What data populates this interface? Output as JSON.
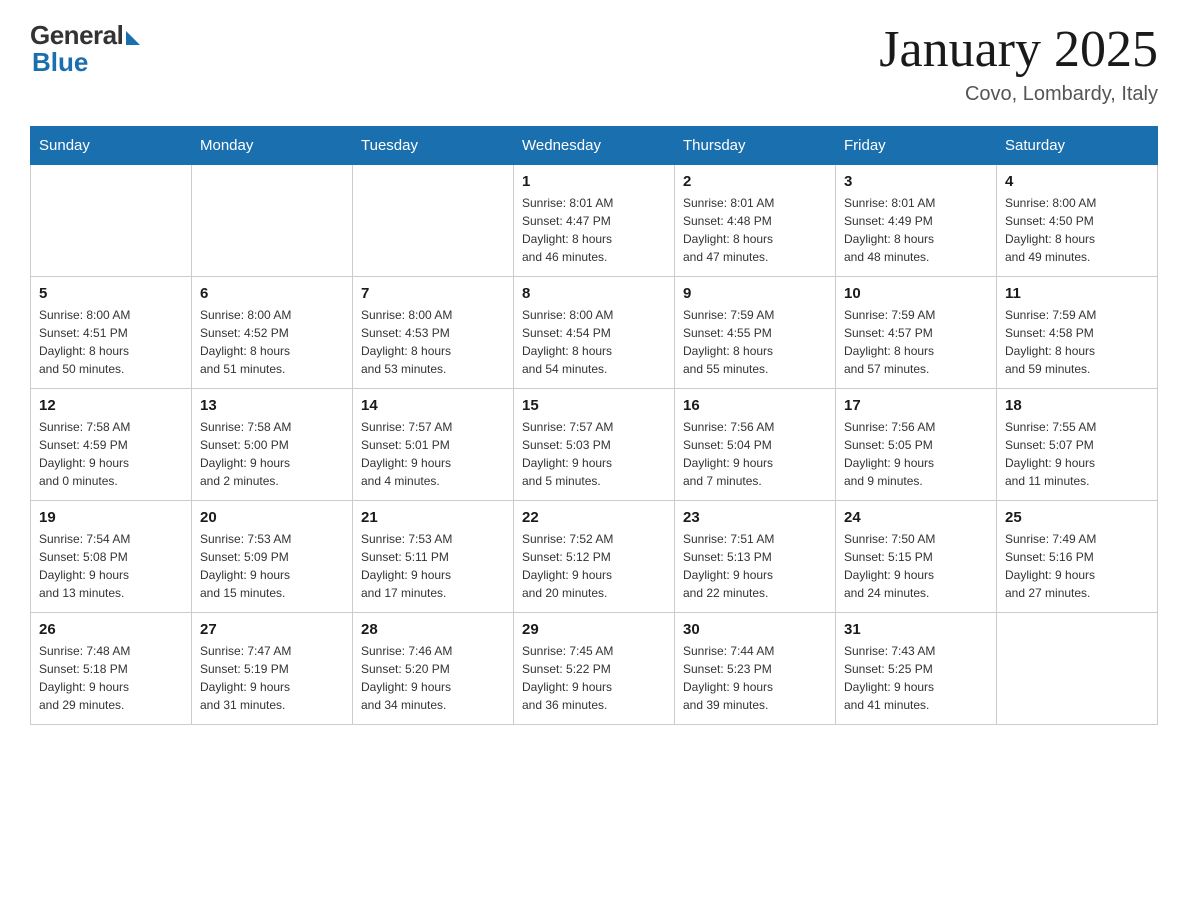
{
  "header": {
    "logo_general": "General",
    "logo_blue": "Blue",
    "month_year": "January 2025",
    "location": "Covo, Lombardy, Italy"
  },
  "days_of_week": [
    "Sunday",
    "Monday",
    "Tuesday",
    "Wednesday",
    "Thursday",
    "Friday",
    "Saturday"
  ],
  "weeks": [
    [
      {
        "num": "",
        "info": ""
      },
      {
        "num": "",
        "info": ""
      },
      {
        "num": "",
        "info": ""
      },
      {
        "num": "1",
        "info": "Sunrise: 8:01 AM\nSunset: 4:47 PM\nDaylight: 8 hours\nand 46 minutes."
      },
      {
        "num": "2",
        "info": "Sunrise: 8:01 AM\nSunset: 4:48 PM\nDaylight: 8 hours\nand 47 minutes."
      },
      {
        "num": "3",
        "info": "Sunrise: 8:01 AM\nSunset: 4:49 PM\nDaylight: 8 hours\nand 48 minutes."
      },
      {
        "num": "4",
        "info": "Sunrise: 8:00 AM\nSunset: 4:50 PM\nDaylight: 8 hours\nand 49 minutes."
      }
    ],
    [
      {
        "num": "5",
        "info": "Sunrise: 8:00 AM\nSunset: 4:51 PM\nDaylight: 8 hours\nand 50 minutes."
      },
      {
        "num": "6",
        "info": "Sunrise: 8:00 AM\nSunset: 4:52 PM\nDaylight: 8 hours\nand 51 minutes."
      },
      {
        "num": "7",
        "info": "Sunrise: 8:00 AM\nSunset: 4:53 PM\nDaylight: 8 hours\nand 53 minutes."
      },
      {
        "num": "8",
        "info": "Sunrise: 8:00 AM\nSunset: 4:54 PM\nDaylight: 8 hours\nand 54 minutes."
      },
      {
        "num": "9",
        "info": "Sunrise: 7:59 AM\nSunset: 4:55 PM\nDaylight: 8 hours\nand 55 minutes."
      },
      {
        "num": "10",
        "info": "Sunrise: 7:59 AM\nSunset: 4:57 PM\nDaylight: 8 hours\nand 57 minutes."
      },
      {
        "num": "11",
        "info": "Sunrise: 7:59 AM\nSunset: 4:58 PM\nDaylight: 8 hours\nand 59 minutes."
      }
    ],
    [
      {
        "num": "12",
        "info": "Sunrise: 7:58 AM\nSunset: 4:59 PM\nDaylight: 9 hours\nand 0 minutes."
      },
      {
        "num": "13",
        "info": "Sunrise: 7:58 AM\nSunset: 5:00 PM\nDaylight: 9 hours\nand 2 minutes."
      },
      {
        "num": "14",
        "info": "Sunrise: 7:57 AM\nSunset: 5:01 PM\nDaylight: 9 hours\nand 4 minutes."
      },
      {
        "num": "15",
        "info": "Sunrise: 7:57 AM\nSunset: 5:03 PM\nDaylight: 9 hours\nand 5 minutes."
      },
      {
        "num": "16",
        "info": "Sunrise: 7:56 AM\nSunset: 5:04 PM\nDaylight: 9 hours\nand 7 minutes."
      },
      {
        "num": "17",
        "info": "Sunrise: 7:56 AM\nSunset: 5:05 PM\nDaylight: 9 hours\nand 9 minutes."
      },
      {
        "num": "18",
        "info": "Sunrise: 7:55 AM\nSunset: 5:07 PM\nDaylight: 9 hours\nand 11 minutes."
      }
    ],
    [
      {
        "num": "19",
        "info": "Sunrise: 7:54 AM\nSunset: 5:08 PM\nDaylight: 9 hours\nand 13 minutes."
      },
      {
        "num": "20",
        "info": "Sunrise: 7:53 AM\nSunset: 5:09 PM\nDaylight: 9 hours\nand 15 minutes."
      },
      {
        "num": "21",
        "info": "Sunrise: 7:53 AM\nSunset: 5:11 PM\nDaylight: 9 hours\nand 17 minutes."
      },
      {
        "num": "22",
        "info": "Sunrise: 7:52 AM\nSunset: 5:12 PM\nDaylight: 9 hours\nand 20 minutes."
      },
      {
        "num": "23",
        "info": "Sunrise: 7:51 AM\nSunset: 5:13 PM\nDaylight: 9 hours\nand 22 minutes."
      },
      {
        "num": "24",
        "info": "Sunrise: 7:50 AM\nSunset: 5:15 PM\nDaylight: 9 hours\nand 24 minutes."
      },
      {
        "num": "25",
        "info": "Sunrise: 7:49 AM\nSunset: 5:16 PM\nDaylight: 9 hours\nand 27 minutes."
      }
    ],
    [
      {
        "num": "26",
        "info": "Sunrise: 7:48 AM\nSunset: 5:18 PM\nDaylight: 9 hours\nand 29 minutes."
      },
      {
        "num": "27",
        "info": "Sunrise: 7:47 AM\nSunset: 5:19 PM\nDaylight: 9 hours\nand 31 minutes."
      },
      {
        "num": "28",
        "info": "Sunrise: 7:46 AM\nSunset: 5:20 PM\nDaylight: 9 hours\nand 34 minutes."
      },
      {
        "num": "29",
        "info": "Sunrise: 7:45 AM\nSunset: 5:22 PM\nDaylight: 9 hours\nand 36 minutes."
      },
      {
        "num": "30",
        "info": "Sunrise: 7:44 AM\nSunset: 5:23 PM\nDaylight: 9 hours\nand 39 minutes."
      },
      {
        "num": "31",
        "info": "Sunrise: 7:43 AM\nSunset: 5:25 PM\nDaylight: 9 hours\nand 41 minutes."
      },
      {
        "num": "",
        "info": ""
      }
    ]
  ]
}
